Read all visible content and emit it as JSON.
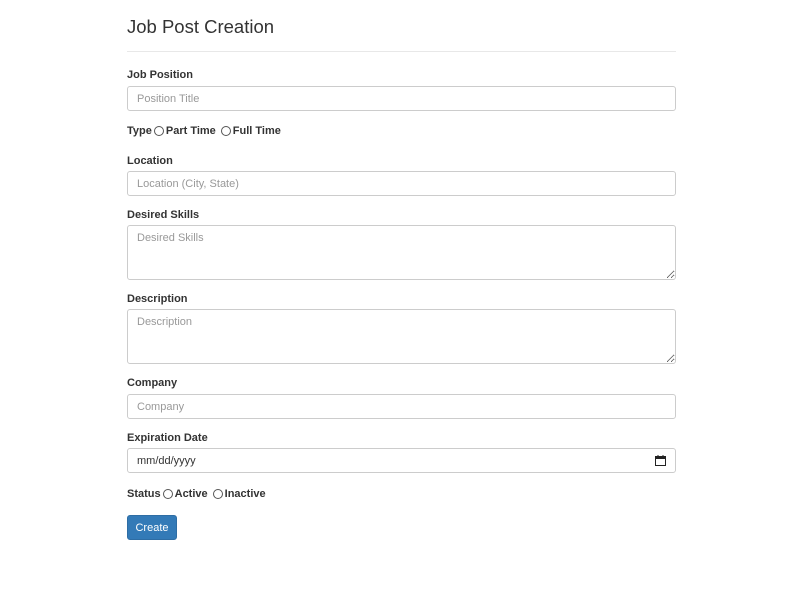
{
  "page": {
    "title": "Job Post Creation"
  },
  "form": {
    "job_position": {
      "label": "Job Position",
      "placeholder": "Position Title",
      "value": ""
    },
    "type": {
      "label": "Type",
      "options": [
        "Part Time",
        "Full Time"
      ],
      "selected": null
    },
    "location": {
      "label": "Location",
      "placeholder": "Location (City, State)",
      "value": ""
    },
    "desired_skills": {
      "label": "Desired Skills",
      "placeholder": "Desired Skills",
      "value": ""
    },
    "description": {
      "label": "Description",
      "placeholder": "Description",
      "value": ""
    },
    "company": {
      "label": "Company",
      "placeholder": "Company",
      "value": ""
    },
    "expiration_date": {
      "label": "Expiration Date",
      "display": "mm/dd/yyyy",
      "icon": "calendar-icon"
    },
    "status": {
      "label": "Status",
      "options": [
        "Active",
        "Inactive"
      ],
      "selected": null
    },
    "submit_label": "Create"
  },
  "colors": {
    "primary": "#337ab7",
    "primary_border": "#2e6da4",
    "text": "#333333",
    "input_border": "#cccccc",
    "placeholder": "#999999"
  }
}
